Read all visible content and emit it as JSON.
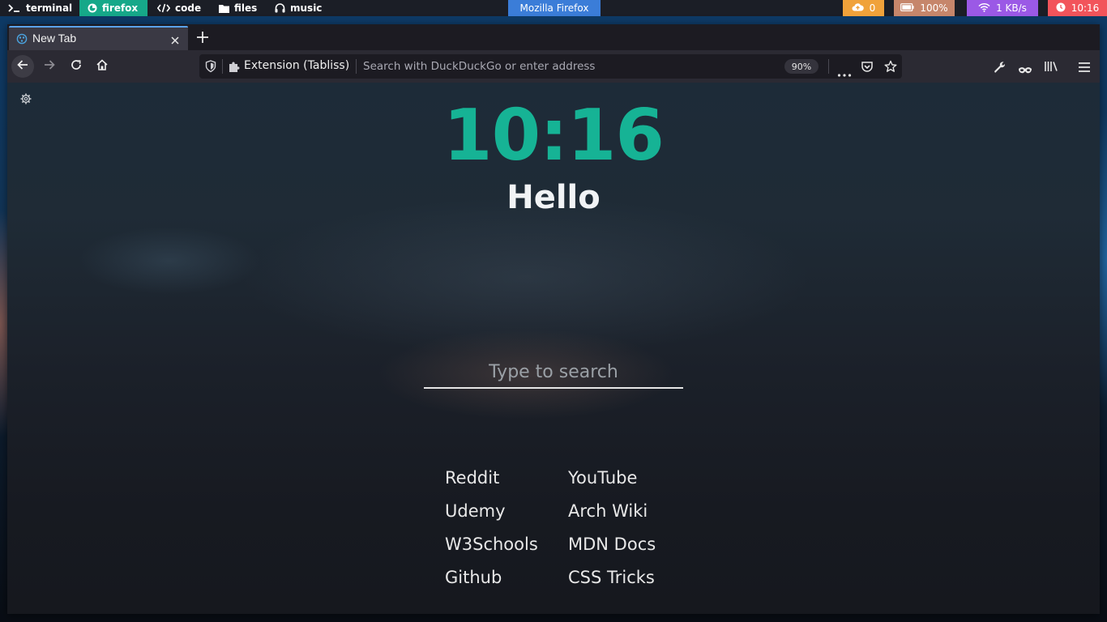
{
  "topbar": {
    "workspaces": [
      {
        "label": "terminal",
        "icon": "terminal-icon",
        "active": false
      },
      {
        "label": "firefox",
        "icon": "firefox-icon",
        "active": true
      },
      {
        "label": "code",
        "icon": "code-icon",
        "active": false
      },
      {
        "label": "files",
        "icon": "folder-icon",
        "active": false
      },
      {
        "label": "music",
        "icon": "headphones-icon",
        "active": false
      }
    ],
    "window_title": "Mozilla Firefox",
    "status": {
      "updates": "0",
      "battery": "100%",
      "network": "1 KB/s",
      "clock": "10:16"
    },
    "colors": {
      "active_workspace": "#16a889",
      "window_title": "#3b7dd8",
      "updates": "#f0a23a",
      "battery": "#c6866b",
      "network": "#9b59e6",
      "clock": "#f2545b"
    }
  },
  "browser": {
    "tab": {
      "title": "New Tab"
    },
    "urlbar": {
      "extension_label": "Extension (Tabliss)",
      "placeholder": "Search with DuckDuckGo or enter address",
      "zoom": "90%"
    }
  },
  "page": {
    "clock": "10:16",
    "greeting": "Hello",
    "search_placeholder": "Type to search",
    "accent_color": "#16b395",
    "links_left": [
      "Reddit",
      "Udemy",
      "W3Schools",
      "Github"
    ],
    "links_right": [
      "YouTube",
      "Arch Wiki",
      "MDN Docs",
      "CSS Tricks"
    ]
  }
}
